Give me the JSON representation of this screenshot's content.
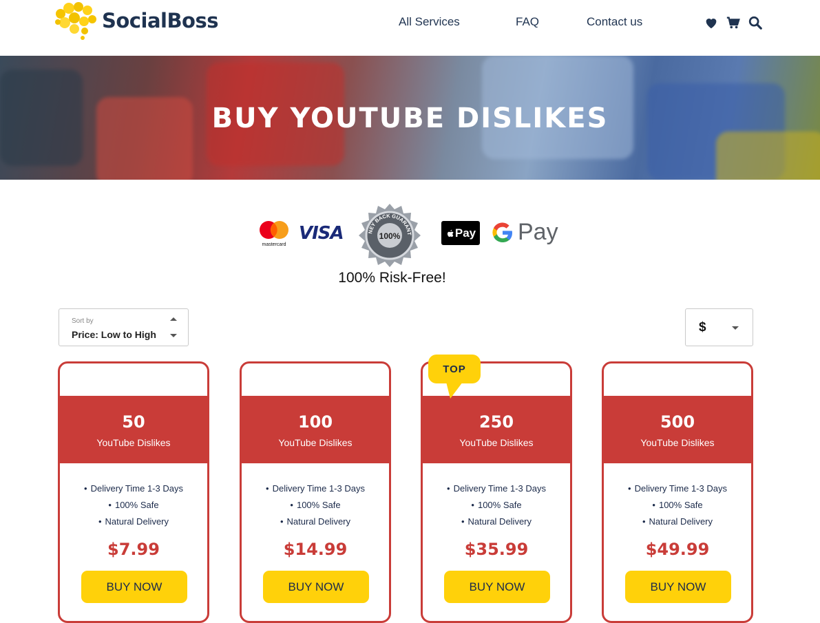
{
  "header": {
    "brand": "SocialBoss",
    "nav": [
      "All Services",
      "FAQ",
      "Contact us"
    ],
    "icons": [
      "heart-icon",
      "cart-icon",
      "search-icon"
    ]
  },
  "hero": {
    "title": "BUY YOUTUBE DISLIKES"
  },
  "payments": {
    "mastercard_label": "mastercard",
    "visa_label": "VISA",
    "seal_text": "100%",
    "seal_ring_text": "MONEY BACK GUARANTEE",
    "applepay_label": "Pay",
    "gpay_label": "Pay",
    "tagline": "100% Risk-Free!"
  },
  "controls": {
    "sort_label": "Sort by",
    "sort_value": "Price: Low to High",
    "currency_value": "$"
  },
  "badge": "TOP",
  "plans": [
    {
      "qty": "50",
      "unit": "YouTube Dislikes",
      "features": [
        "Delivery Time 1-3 Days",
        "100% Safe",
        "Natural Delivery"
      ],
      "price": "$7.99",
      "button": "BUY NOW"
    },
    {
      "qty": "100",
      "unit": "YouTube Dislikes",
      "features": [
        "Delivery Time 1-3 Days",
        "100% Safe",
        "Natural Delivery"
      ],
      "price": "$14.99",
      "button": "BUY NOW"
    },
    {
      "qty": "250",
      "unit": "YouTube Dislikes",
      "features": [
        "Delivery Time 1-3 Days",
        "100% Safe",
        "Natural Delivery"
      ],
      "price": "$35.99",
      "button": "BUY NOW"
    },
    {
      "qty": "500",
      "unit": "YouTube Dislikes",
      "features": [
        "Delivery Time 1-3 Days",
        "100% Safe",
        "Natural Delivery"
      ],
      "price": "$49.99",
      "button": "BUY NOW"
    }
  ],
  "colors": {
    "accent_red": "#c93c38",
    "accent_yellow": "#ffd10a",
    "navy": "#1f3350"
  }
}
